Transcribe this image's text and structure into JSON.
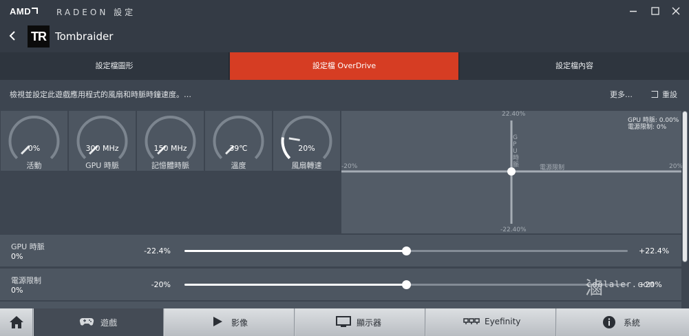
{
  "titlebar": {
    "brand": "AMD",
    "product": "RADEON 設定",
    "min_icon": "minimize-icon",
    "max_icon": "maximize-icon",
    "close_icon": "close-icon"
  },
  "header": {
    "back_icon": "chevron-left-icon",
    "game_logo": "TR",
    "game_title": "Tombraider"
  },
  "tabs": [
    {
      "label": "設定檔圖形",
      "active": false
    },
    {
      "label": "設定檔 OverDrive",
      "active": true
    },
    {
      "label": "設定檔內容",
      "active": false
    }
  ],
  "description": "檢視並設定此遊戲應用程式的風扇和時脈時鐘速度。…",
  "more_label": "更多…",
  "reset_label": "重設",
  "gauges": [
    {
      "value": "0%",
      "label": "活動",
      "level": 0.0
    },
    {
      "value": "300 MHz",
      "label": "GPU 時脈",
      "level": 0.0
    },
    {
      "value": "150 MHz",
      "label": "記憶體時脈",
      "level": 0.0
    },
    {
      "value": "39℃",
      "label": "溫度",
      "level": 0.0
    },
    {
      "value": "20%",
      "label": "風扇轉速",
      "level": 0.2
    }
  ],
  "graph": {
    "y_top": "22.40%",
    "y_bottom": "-22.40%",
    "x_left": "-20%",
    "x_right": "20%",
    "x_axis_label": "電源限制",
    "y_axis_label": "GPU時脈",
    "readout_gpu": "GPU 時脈: 0.00%",
    "readout_power": "電源限制: 0%",
    "point_x": 0,
    "point_y": 0,
    "x_range": [
      -20,
      20
    ],
    "y_range": [
      -22.4,
      22.4
    ]
  },
  "sliders": [
    {
      "name": "GPU 時脈",
      "value": "0%",
      "min_label": "-22.4%",
      "max_label": "+22.4%",
      "level": 0.5
    },
    {
      "name": "電源限制",
      "value": "0%",
      "min_label": "-20%",
      "max_label": "+20%",
      "level": 0.5
    }
  ],
  "watermark": {
    "glyph": "滷",
    "text": "coolaler.com"
  },
  "bottom_nav": [
    {
      "label": "遊戲",
      "icon": "gamepad-icon",
      "active": true
    },
    {
      "label": "影像",
      "icon": "play-icon",
      "active": false
    },
    {
      "label": "顯示器",
      "icon": "monitor-icon",
      "active": false
    },
    {
      "label": "Eyefinity",
      "icon": "eyefinity-icon",
      "active": false
    },
    {
      "label": "系統",
      "icon": "info-icon",
      "active": false
    }
  ],
  "home_icon": "home-icon"
}
